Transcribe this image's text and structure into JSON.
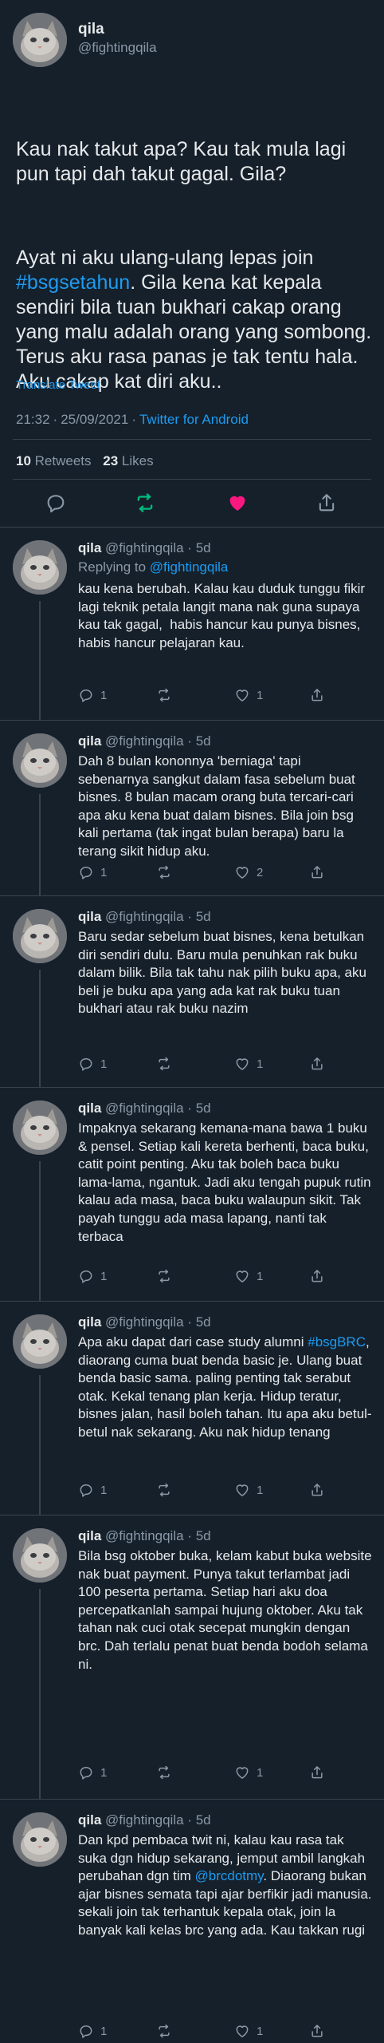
{
  "main": {
    "name": "qila",
    "handle": "@fightingqila",
    "para1": "Kau nak takut apa? Kau tak mula lagi pun tapi dah takut gagal. Gila?",
    "para2_before": "Ayat ni aku ulang-ulang lepas join ",
    "para2_hashtag": "#bsgsetahun",
    "para2_after": ". Gila kena kat kepala sendiri bila tuan bukhari cakap orang yang malu adalah orang yang sombong. Terus aku rasa panas je tak tentu hala. Aku cakap kat diri aku..",
    "translate": "Translate Tweet",
    "time": "21:32",
    "date": "25/09/2021",
    "source": "Twitter for Android",
    "retweet_count": "10",
    "retweet_label": "Retweets",
    "like_count": "23",
    "like_label": "Likes",
    "like_color": "#f91880",
    "retweet_color": "#00ba7c"
  },
  "replies": [
    {
      "name": "qila",
      "handle": "@fightingqila",
      "age": "5d",
      "replying_label": "Replying to",
      "replying_to": "@fightingqila",
      "text": "kau kena berubah. Kalau kau duduk tunggu fikir lagi teknik petala langit mana nak guna supaya kau tak gagal,  habis hancur kau punya bisnes, habis hancur pelajaran kau.",
      "replies": "1",
      "likes": "1"
    },
    {
      "name": "qila",
      "handle": "@fightingqila",
      "age": "5d",
      "text": "Dah 8 bulan kononnya 'berniaga' tapi sebenarnya sangkut dalam fasa sebelum buat bisnes. 8 bulan macam orang buta tercari-cari apa aku kena buat dalam bisnes. Bila join bsg kali pertama (tak ingat bulan berapa) baru la terang sikit hidup aku.",
      "replies": "1",
      "likes": "2"
    },
    {
      "name": "qila",
      "handle": "@fightingqila",
      "age": "5d",
      "text": "Baru sedar sebelum buat bisnes, kena betulkan diri sendiri dulu. Baru mula penuhkan rak buku dalam bilik. Bila tak tahu nak pilih buku apa, aku beli je buku apa yang ada kat rak buku tuan bukhari atau rak buku nazim",
      "replies": "1",
      "likes": "1"
    },
    {
      "name": "qila",
      "handle": "@fightingqila",
      "age": "5d",
      "text": "Impaknya sekarang kemana-mana bawa 1 buku & pensel. Setiap kali kereta berhenti, baca buku, catit point penting. Aku tak boleh baca buku lama-lama, ngantuk. Jadi aku tengah pupuk rutin kalau ada masa, baca buku walaupun sikit. Tak payah tunggu ada masa lapang, nanti tak terbaca",
      "replies": "1",
      "likes": "1"
    },
    {
      "name": "qila",
      "handle": "@fightingqila",
      "age": "5d",
      "text_before": "Apa aku dapat dari case study alumni ",
      "hashtag": "#bsgBRC",
      "text_after": ", diaorang cuma buat benda basic je. Ulang buat benda basic sama. paling penting tak serabut otak. Kekal tenang plan kerja. Hidup teratur, bisnes jalan, hasil boleh tahan. Itu apa aku betul-betul nak sekarang. Aku nak hidup tenang",
      "replies": "1",
      "likes": "1"
    },
    {
      "name": "qila",
      "handle": "@fightingqila",
      "age": "5d",
      "text": "Bila bsg oktober buka, kelam kabut buka website nak buat payment. Punya takut terlambat jadi 100 peserta pertama. Setiap hari aku doa percepatkanlah sampai hujung oktober. Aku tak tahan nak cuci otak secepat mungkin dengan brc. Dah terlalu penat buat benda bodoh selama ni.",
      "replies": "1",
      "likes": "1"
    },
    {
      "name": "qila",
      "handle": "@fightingqila",
      "age": "5d",
      "text_before": "Dan kpd pembaca twit ni, kalau kau rasa tak suka dgn hidup sekarang, jemput ambil langkah perubahan dgn tim ",
      "mention": "@brcdotmy",
      "text_after": ". Diaorang bukan ajar bisnes semata tapi ajar berfikir jadi manusia. sekali join tak terhantuk kepala otak, join la banyak kali kelas brc yang ada. Kau takkan rugi",
      "replies": "1",
      "likes": "1"
    }
  ]
}
